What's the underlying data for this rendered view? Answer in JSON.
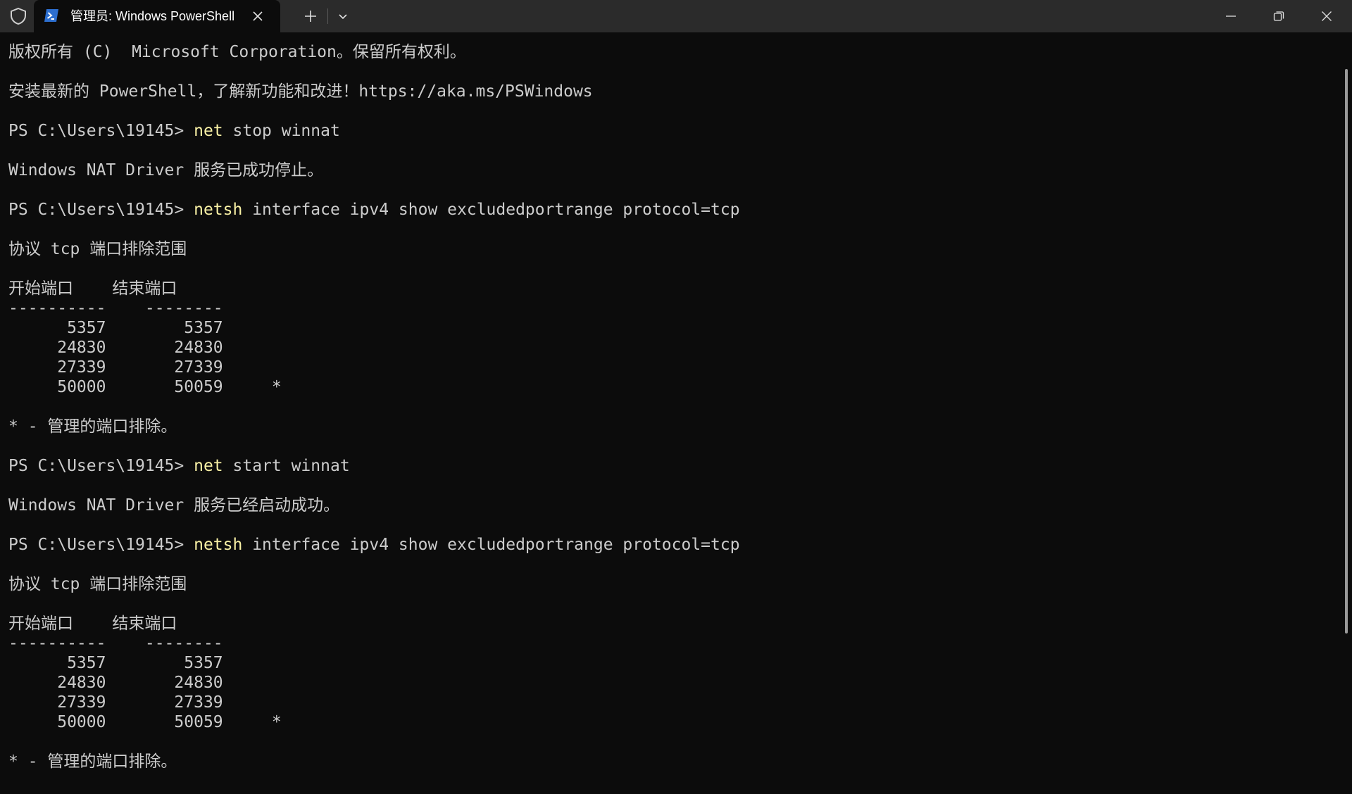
{
  "titlebar": {
    "tab_title": "管理员: Windows PowerShell",
    "icons": {
      "shield": "shield-icon",
      "powershell": "powershell-icon",
      "close_tab": "close-icon",
      "new_tab": "plus-icon",
      "dropdown": "chevron-down-icon",
      "minimize": "minimize-icon",
      "restore": "restore-icon",
      "close_window": "close-icon"
    }
  },
  "terminal": {
    "colors": {
      "background": "#0c0c0c",
      "text": "#cccccc",
      "command": "#f9f1a5"
    },
    "lines": [
      {
        "text": "版权所有 (C)  Microsoft Corporation。保留所有权利。"
      },
      {
        "text": ""
      },
      {
        "text": "安装最新的 PowerShell，了解新功能和改进！https://aka.ms/PSWindows"
      },
      {
        "text": ""
      },
      {
        "prompt": "PS C:\\Users\\19145> ",
        "cmd": "net",
        "args": " stop winnat"
      },
      {
        "text": ""
      },
      {
        "text": "Windows NAT Driver 服务已成功停止。"
      },
      {
        "text": ""
      },
      {
        "prompt": "PS C:\\Users\\19145> ",
        "cmd": "netsh",
        "args": " interface ipv4 show excludedportrange protocol=tcp"
      },
      {
        "text": ""
      },
      {
        "text": "协议 tcp 端口排除范围"
      },
      {
        "text": ""
      },
      {
        "text": "开始端口    结束端口"
      },
      {
        "text": "----------    --------"
      },
      {
        "text": "      5357        5357"
      },
      {
        "text": "     24830       24830"
      },
      {
        "text": "     27339       27339"
      },
      {
        "text": "     50000       50059     *"
      },
      {
        "text": ""
      },
      {
        "text": "* - 管理的端口排除。"
      },
      {
        "text": ""
      },
      {
        "prompt": "PS C:\\Users\\19145> ",
        "cmd": "net",
        "args": " start winnat"
      },
      {
        "text": ""
      },
      {
        "text": "Windows NAT Driver 服务已经启动成功。"
      },
      {
        "text": ""
      },
      {
        "prompt": "PS C:\\Users\\19145> ",
        "cmd": "netsh",
        "args": " interface ipv4 show excludedportrange protocol=tcp"
      },
      {
        "text": ""
      },
      {
        "text": "协议 tcp 端口排除范围"
      },
      {
        "text": ""
      },
      {
        "text": "开始端口    结束端口"
      },
      {
        "text": "----------    --------"
      },
      {
        "text": "      5357        5357"
      },
      {
        "text": "     24830       24830"
      },
      {
        "text": "     27339       27339"
      },
      {
        "text": "     50000       50059     *"
      },
      {
        "text": ""
      },
      {
        "text": "* - 管理的端口排除。"
      }
    ]
  }
}
